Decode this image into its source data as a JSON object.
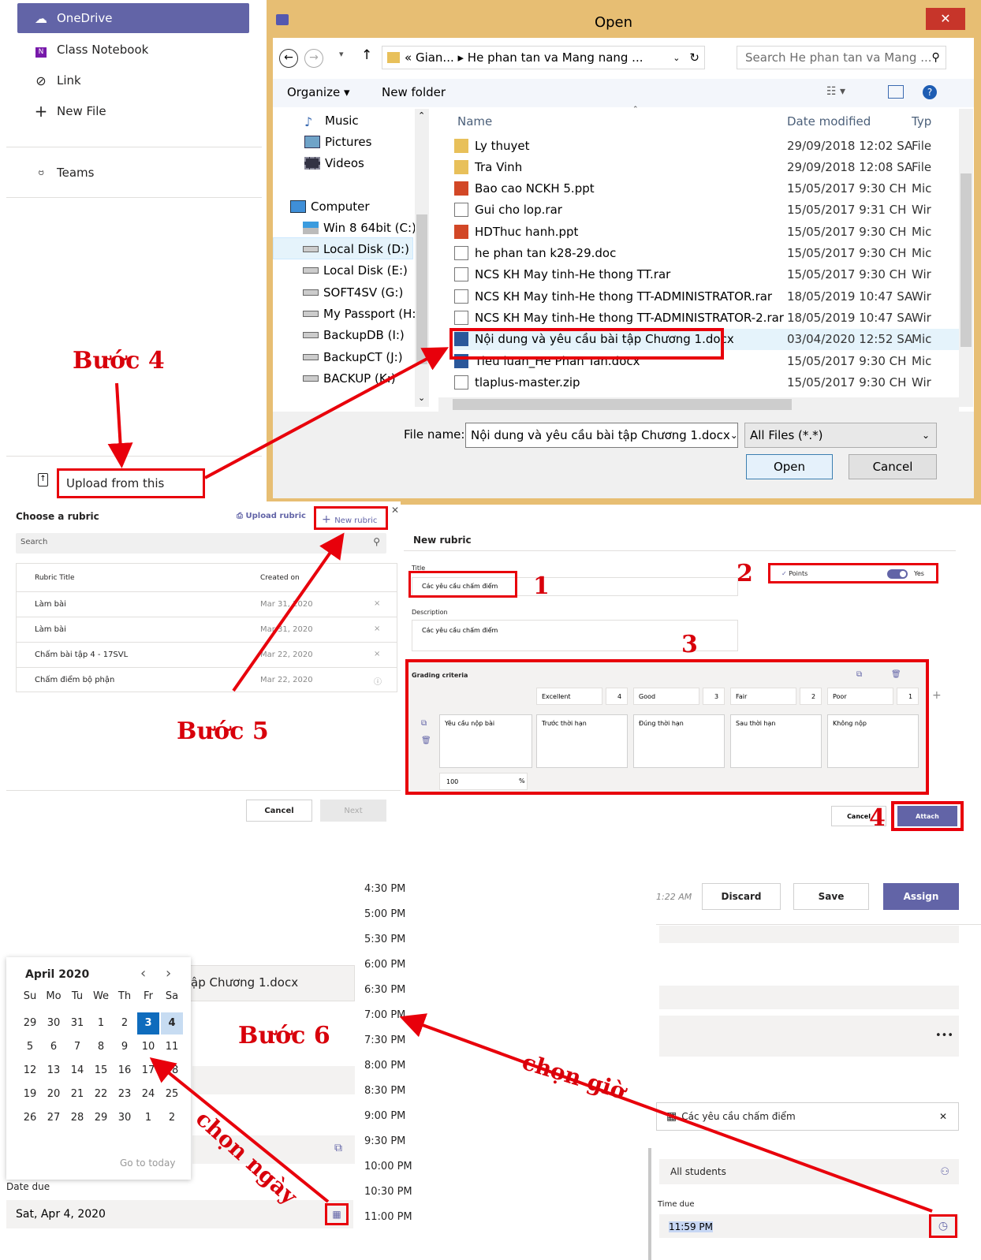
{
  "teams_panel": {
    "items": [
      {
        "label": "OneDrive",
        "icon": "cloud-icon"
      },
      {
        "label": "Class Notebook",
        "icon": "onenote-icon"
      },
      {
        "label": "Link",
        "icon": "link-icon"
      },
      {
        "label": "New File",
        "icon": "plus-icon"
      },
      {
        "label": "Teams",
        "icon": "teams-icon"
      }
    ],
    "upload_label": "Upload from this device"
  },
  "open_dialog": {
    "title": "Open",
    "path": "« Gian...  ▸  He phan tan va Mang nang ...",
    "search_placeholder": "Search He phan tan va Mang ...",
    "organize": "Organize ▾",
    "new_folder": "New folder",
    "tree": [
      "Music",
      "Pictures",
      "Videos",
      "Computer",
      "Win 8 64bit (C:)",
      "Local Disk (D:)",
      "Local Disk (E:)",
      "SOFT4SV (G:)",
      "My Passport (H:)",
      "BackupDB (I:)",
      "BackupCT (J:)",
      "BACKUP (K:)"
    ],
    "columns": {
      "name": "Name",
      "date": "Date modified",
      "type": "Typ"
    },
    "files": [
      {
        "name": "Ly thuyet",
        "date": "29/09/2018 12:02 SA",
        "type": "File",
        "icon": "folder"
      },
      {
        "name": "Tra Vinh",
        "date": "29/09/2018 12:08 SA",
        "type": "File",
        "icon": "folder"
      },
      {
        "name": "Bao cao NCKH 5.ppt",
        "date": "15/05/2017 9:30 CH",
        "type": "Mic",
        "icon": "ppt"
      },
      {
        "name": "Gui cho lop.rar",
        "date": "15/05/2017 9:31 CH",
        "type": "Wir",
        "icon": "blank"
      },
      {
        "name": "HDThuc hanh.ppt",
        "date": "15/05/2017 9:30 CH",
        "type": "Mic",
        "icon": "ppt"
      },
      {
        "name": "he phan tan k28-29.doc",
        "date": "15/05/2017 9:30 CH",
        "type": "Mic",
        "icon": "blank"
      },
      {
        "name": "NCS KH May tinh-He thong TT.rar",
        "date": "15/05/2017 9:30 CH",
        "type": "Wir",
        "icon": "blank"
      },
      {
        "name": "NCS KH May tinh-He thong TT-ADMINISTRATOR.rar",
        "date": "18/05/2019 10:47 SA",
        "type": "Wir",
        "icon": "blank"
      },
      {
        "name": "NCS KH May tinh-He thong TT-ADMINISTRATOR-2.rar",
        "date": "18/05/2019 10:47 SA",
        "type": "Wir",
        "icon": "blank"
      },
      {
        "name": "Nội dung và yêu cầu bài tập Chương 1.docx",
        "date": "03/04/2020 12:52 SA",
        "type": "Mic",
        "icon": "word"
      },
      {
        "name": "Tieu luan_He Phan Tan.docx",
        "date": "15/05/2017 9:30 CH",
        "type": "Mic",
        "icon": "word"
      },
      {
        "name": "tlaplus-master.zip",
        "date": "15/05/2017 9:30 CH",
        "type": "Wir",
        "icon": "blank"
      }
    ],
    "file_name_label": "File name:",
    "file_name_value": "Nội dung và yêu cầu bài tập Chương 1.docx",
    "filter": "All Files (*.*)",
    "open_btn": "Open",
    "cancel_btn": "Cancel"
  },
  "choose_rubric": {
    "title": "Choose a rubric",
    "upload": "Upload rubric",
    "new": "New rubric",
    "search_placeholder": "Search",
    "col_title": "Rubric Title",
    "col_created": "Created on",
    "rows": [
      {
        "title": "Làm bài",
        "date": "Mar 31, 2020",
        "action": "×"
      },
      {
        "title": "Làm bài",
        "date": "Mar 31, 2020",
        "action": "×"
      },
      {
        "title": "Chấm bài tập 4 - 17SVL",
        "date": "Mar 22, 2020",
        "action": "×"
      },
      {
        "title": "Chấm điểm bộ phận",
        "date": "Mar 22, 2020",
        "action": "ⓘ"
      }
    ],
    "cancel": "Cancel",
    "next": "Next"
  },
  "new_rubric": {
    "heading": "New rubric",
    "title_label": "Title",
    "title_value": "Các yêu cầu chấm điểm",
    "points_label": "Points",
    "points_toggle": "Yes",
    "desc_label": "Description",
    "desc_value": "Các yêu cầu chấm điểm",
    "grading_label": "Grading criteria",
    "levels": [
      {
        "name": "Excellent",
        "pts": "4"
      },
      {
        "name": "Good",
        "pts": "3"
      },
      {
        "name": "Fair",
        "pts": "2"
      },
      {
        "name": "Poor",
        "pts": "1"
      }
    ],
    "criterion": "Yêu cầu nộp bài",
    "descriptions": [
      "Trước thời hạn",
      "Đúng thời hạn",
      "Sau thời hạn",
      "Không nộp"
    ],
    "weight": "100",
    "weight_unit": "%",
    "cancel": "Cancel",
    "attach": "Attach"
  },
  "assignment": {
    "time_saved": "1:22 AM",
    "discard": "Discard",
    "save": "Save",
    "assign": "Assign",
    "file_fragment": "ập Chương 1.docx",
    "rubric_chip": "Các yêu cầu chấm điểm",
    "students": "All students",
    "time_due_label": "Time due",
    "time_due_value": "11:59 PM",
    "date_due_label": "Date due",
    "date_due_value": "Sat, Apr 4, 2020",
    "more": "•••"
  },
  "calendar": {
    "month": "April 2020",
    "weekdays": [
      "Su",
      "Mo",
      "Tu",
      "We",
      "Th",
      "Fr",
      "Sa"
    ],
    "weeks": [
      [
        "29",
        "30",
        "31",
        "1",
        "2",
        "3",
        "4"
      ],
      [
        "5",
        "6",
        "7",
        "8",
        "9",
        "10",
        "11"
      ],
      [
        "12",
        "13",
        "14",
        "15",
        "16",
        "17",
        "18"
      ],
      [
        "19",
        "20",
        "21",
        "22",
        "23",
        "24",
        "25"
      ],
      [
        "26",
        "27",
        "28",
        "29",
        "30",
        "1",
        "2"
      ]
    ],
    "goto": "Go to today"
  },
  "times": [
    "4:30 PM",
    "5:00 PM",
    "5:30 PM",
    "6:00 PM",
    "6:30 PM",
    "7:00 PM",
    "7:30 PM",
    "8:00 PM",
    "8:30 PM",
    "9:00 PM",
    "9:30 PM",
    "10:00 PM",
    "10:30 PM",
    "11:00 PM"
  ],
  "annotations": {
    "step4": "Bước 4",
    "step5": "Bước 5",
    "step6": "Bước 6",
    "n1": "1",
    "n2": "2",
    "n3": "3",
    "n4": "4",
    "pick_date": "chọn ngày",
    "pick_time": "chọn giờ"
  },
  "colors": {
    "accent": "#6264a7",
    "red": "#e8000b",
    "dialog_frame": "#e7be73"
  }
}
